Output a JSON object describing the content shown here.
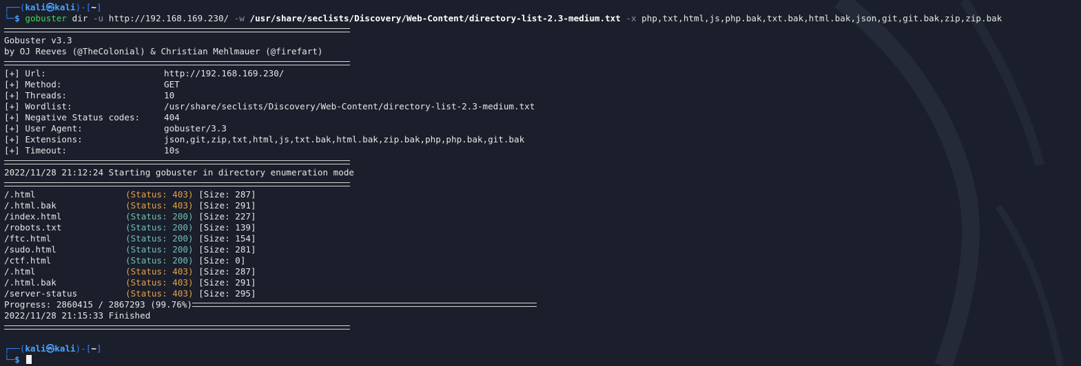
{
  "prompt": {
    "box_top": "┌──(",
    "box_bottom": "└─",
    "user": "kali",
    "at": "㉿",
    "host": "kali",
    "dir_open": ")-[",
    "dir": "~",
    "dir_close": "]",
    "dollar": "$"
  },
  "command": {
    "bin": "gobuster",
    "sub": "dir",
    "flag_u": "-u",
    "url": "http://192.168.169.230/",
    "flag_w": "-w",
    "wordlist": "/usr/share/seclists/Discovery/Web-Content/directory-list-2.3-medium.txt",
    "flag_x": "-x",
    "extensions": "php,txt,html,js,php.bak,txt.bak,html.bak,json,git,git.bak,zip,zip.bak"
  },
  "banner": {
    "version": "Gobuster v3.3",
    "authors": "by OJ Reeves (@TheColonial) & Christian Mehlmauer (@firefart)"
  },
  "config": [
    {
      "key": "[+] Url:",
      "value": "http://192.168.169.230/"
    },
    {
      "key": "[+] Method:",
      "value": "GET"
    },
    {
      "key": "[+] Threads:",
      "value": "10"
    },
    {
      "key": "[+] Wordlist:",
      "value": "/usr/share/seclists/Discovery/Web-Content/directory-list-2.3-medium.txt"
    },
    {
      "key": "[+] Negative Status codes:",
      "value": "404"
    },
    {
      "key": "[+] User Agent:",
      "value": "gobuster/3.3"
    },
    {
      "key": "[+] Extensions:",
      "value": "json,git,zip,txt,html,js,txt.bak,html.bak,zip.bak,php,php.bak,git.bak"
    },
    {
      "key": "[+] Timeout:",
      "value": "10s"
    }
  ],
  "start_line": "2022/11/28 21:12:24 Starting gobuster in directory enumeration mode",
  "results": [
    {
      "path": "/.html",
      "status": "(Status: 403)",
      "size": "[Size: 287]",
      "color": "#e2a04a"
    },
    {
      "path": "/.html.bak",
      "status": "(Status: 403)",
      "size": "[Size: 291]",
      "color": "#e2a04a"
    },
    {
      "path": "/index.html",
      "status": "(Status: 200)",
      "size": "[Size: 227]",
      "color": "#6fbfb2"
    },
    {
      "path": "/robots.txt",
      "status": "(Status: 200)",
      "size": "[Size: 139]",
      "color": "#6fbfb2"
    },
    {
      "path": "/ftc.html",
      "status": "(Status: 200)",
      "size": "[Size: 154]",
      "color": "#6fbfb2"
    },
    {
      "path": "/sudo.html",
      "status": "(Status: 200)",
      "size": "[Size: 281]",
      "color": "#6fbfb2"
    },
    {
      "path": "/ctf.html",
      "status": "(Status: 200)",
      "size": "[Size: 0]",
      "color": "#6fbfb2"
    },
    {
      "path": "/.html",
      "status": "(Status: 403)",
      "size": "[Size: 287]",
      "color": "#e2a04a"
    },
    {
      "path": "/.html.bak",
      "status": "(Status: 403)",
      "size": "[Size: 291]",
      "color": "#e2a04a"
    },
    {
      "path": "/server-status",
      "status": "(Status: 403)",
      "size": "[Size: 295]",
      "color": "#e2a04a"
    }
  ],
  "progress": {
    "text": "Progress: 2860415 / 2867293 (99.76%)",
    "fraction": 0.9976
  },
  "finish_line": "2022/11/28 21:15:33 Finished",
  "colors": {
    "background": "#1b1f2b",
    "prompt_blue": "#2f7fff",
    "command_green": "#3fd85a",
    "status_403": "#e2a04a",
    "status_200": "#6fbfb2"
  }
}
